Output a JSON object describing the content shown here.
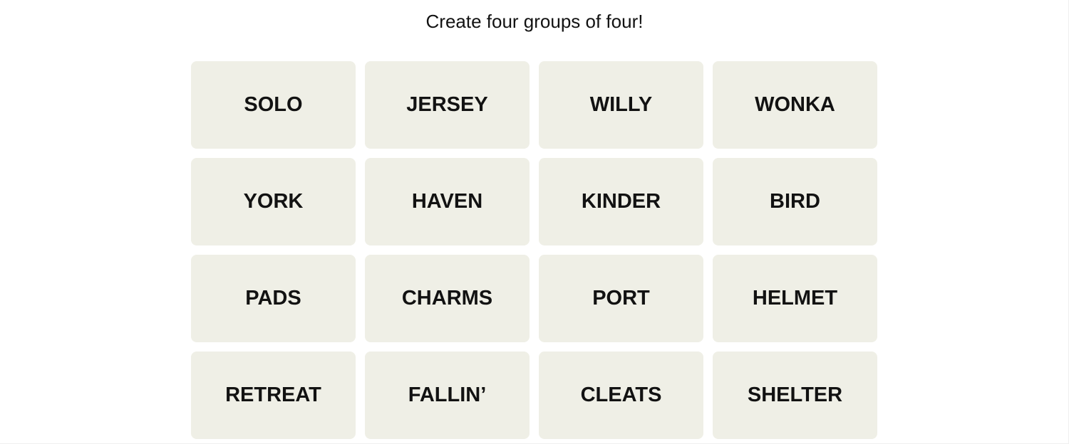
{
  "game": {
    "instructions": "Create four groups of four!",
    "tiles": [
      "SOLO",
      "JERSEY",
      "WILLY",
      "WONKA",
      "YORK",
      "HAVEN",
      "KINDER",
      "BIRD",
      "PADS",
      "CHARMS",
      "PORT",
      "HELMET",
      "RETREAT",
      "FALLIN’",
      "CLEATS",
      "SHELTER"
    ],
    "colors": {
      "tile_background": "#efefe6",
      "tile_text": "#121212"
    }
  }
}
